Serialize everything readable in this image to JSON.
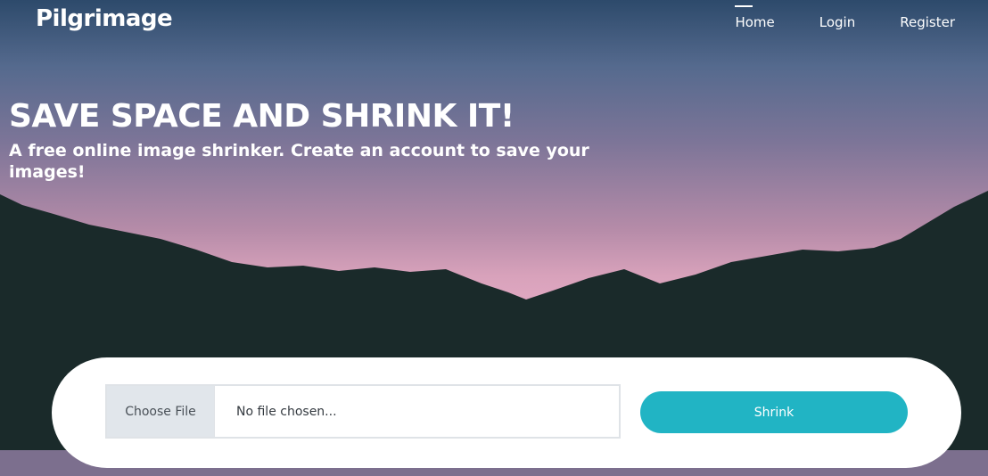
{
  "header": {
    "brand": "Pilgrimage",
    "nav": [
      {
        "label": "Home",
        "active": true
      },
      {
        "label": "Login",
        "active": false
      },
      {
        "label": "Register",
        "active": false
      }
    ]
  },
  "hero": {
    "title": "SAVE SPACE AND SHRINK IT!",
    "subtitle": "A free online image shrinker. Create an account to save your images!"
  },
  "upload": {
    "choose_label": "Choose File",
    "file_status": "No file chosen...",
    "submit_label": "Shrink"
  },
  "colors": {
    "accent": "#21b4c4",
    "mountain": "#1a2a2a",
    "sky_top": "#2d4a6b",
    "sky_bottom": "#e3aac4"
  }
}
